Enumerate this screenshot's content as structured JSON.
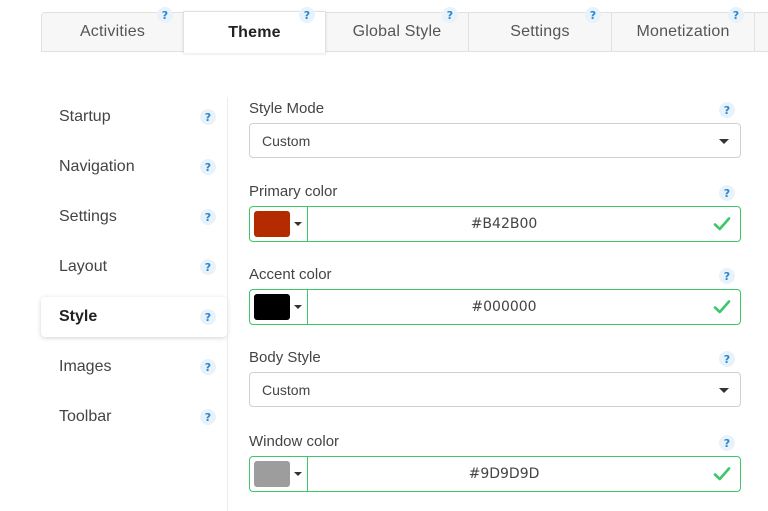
{
  "tabs": [
    {
      "label": "Activities",
      "help": "?"
    },
    {
      "label": "Theme",
      "help": "?"
    },
    {
      "label": "Global Style",
      "help": "?"
    },
    {
      "label": "Settings",
      "help": "?"
    },
    {
      "label": "Monetization",
      "help": "?"
    }
  ],
  "sidebar": {
    "items": [
      {
        "label": "Startup",
        "help": "?"
      },
      {
        "label": "Navigation",
        "help": "?"
      },
      {
        "label": "Settings",
        "help": "?"
      },
      {
        "label": "Layout",
        "help": "?"
      },
      {
        "label": "Style",
        "help": "?"
      },
      {
        "label": "Images",
        "help": "?"
      },
      {
        "label": "Toolbar",
        "help": "?"
      }
    ],
    "active_index": 4
  },
  "form": {
    "style_mode": {
      "label": "Style Mode",
      "value": "Custom",
      "help": "?"
    },
    "primary_color": {
      "label": "Primary color",
      "value": "#B42B00",
      "swatch": "#B42B00",
      "help": "?"
    },
    "accent_color": {
      "label": "Accent color",
      "value": "#000000",
      "swatch": "#000000",
      "help": "?"
    },
    "body_style": {
      "label": "Body Style",
      "value": "Custom",
      "help": "?"
    },
    "window_color": {
      "label": "Window color",
      "value": "#9D9D9D",
      "swatch": "#9D9D9D",
      "help": "?"
    }
  },
  "colors": {
    "valid": "#3cc76a",
    "help_icon": "#2b86d0"
  }
}
